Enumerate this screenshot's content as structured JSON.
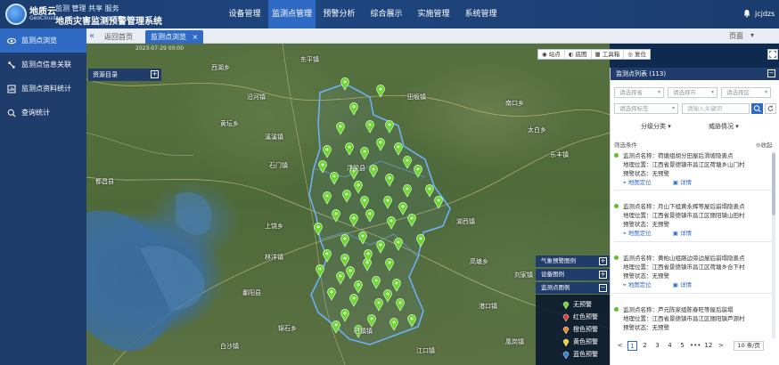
{
  "header": {
    "logo_text": "地质云",
    "logo_sub": "GeoCloud",
    "slogan": "监测 管理 共享 服务",
    "title": "地质灾害监测预警管理系统",
    "nav": [
      "设备管理",
      "监测点管理",
      "预警分析",
      "综合展示",
      "实施管理",
      "系统管理"
    ],
    "active_nav": 1,
    "username": "jcjdzs"
  },
  "sidebar": {
    "items": [
      {
        "label": "监测点浏览",
        "icon": "eye-icon"
      },
      {
        "label": "监测点信息关联",
        "icon": "link-icon"
      },
      {
        "label": "监测点资料统计",
        "icon": "chart-icon"
      },
      {
        "label": "查询统计",
        "icon": "search-icon"
      }
    ],
    "active": 0
  },
  "tabs": {
    "items": [
      "返回首页",
      "监测点浏览"
    ],
    "active": 1,
    "right_label": "页面"
  },
  "map": {
    "resource_dir": "资源目录",
    "timestamp": "2023-07-29 00:00",
    "places": [
      {
        "label": "东平镇"
      },
      {
        "label": "西湖乡"
      },
      {
        "label": "沿河镇"
      },
      {
        "label": "黄坛乡"
      },
      {
        "label": "田坂镇"
      },
      {
        "label": "南口乡"
      },
      {
        "label": "太白乡"
      },
      {
        "label": "溪溪镇"
      },
      {
        "label": "石门镇"
      },
      {
        "label": "乐丰镇"
      },
      {
        "label": "都昌县"
      },
      {
        "label": "鄱阳县"
      },
      {
        "label": "上饶乡"
      },
      {
        "label": "林洋镇"
      },
      {
        "label": "湖西镇"
      },
      {
        "label": "高塘乡"
      },
      {
        "label": "刘家镇"
      },
      {
        "label": "港口镇"
      },
      {
        "label": "江口镇"
      },
      {
        "label": "浮梁县"
      },
      {
        "label": "锦石乡"
      },
      {
        "label": "白沙镇"
      },
      {
        "label": "凰岗镇"
      },
      {
        "label": "石镇镇"
      }
    ],
    "toolbar": [
      "站点",
      "底图",
      "工具箱",
      "复位"
    ],
    "layer_headers": [
      "气象预警图例",
      "设备图例",
      "监测点图例"
    ],
    "legend_title": "监测点图例",
    "legend_items": [
      {
        "label": "无预警",
        "color": "#6cd92e"
      },
      {
        "label": "红色预警",
        "color": "#e23b2e"
      },
      {
        "label": "橙色预警",
        "color": "#f08a1f"
      },
      {
        "label": "黄色预警",
        "color": "#f2d21a"
      },
      {
        "label": "蓝色预警",
        "color": "#2f7fe0"
      }
    ]
  },
  "panel": {
    "title": "监测点列表",
    "count": "(113)",
    "selects": [
      "请选择省",
      "请选择市",
      "请选择区",
      "请选择标签",
      "请输入关键词"
    ],
    "filters": [
      "分级分类",
      "威胁情况"
    ],
    "cond_label": "筛选条件",
    "collapse_label": "收起",
    "card_actions": [
      "地图定位",
      "详情"
    ],
    "cards": [
      {
        "name": "监测点名称：荷塘组胡分田屋后滑坡隐患点",
        "loc": "地理位置：江西省景德镇市昌江区荷塘乡山门村",
        "status": "预警状态：无预警"
      },
      {
        "name": "监测点名称：月山下组黄永辉等屋后崩塌隐患点",
        "loc": "地理位置：江西省景德镇市昌江区丽阳镇山田村",
        "status": "预警状态：无预警"
      },
      {
        "name": "监测点名称：黄柏山组路边旁边屋后崩塌隐患点",
        "loc": "地理位置：江西省景德镇市昌江区荷塘乡合下村",
        "status": "预警状态：无预警"
      },
      {
        "name": "监测点名称：芦元陈家组陈春旺等屋后崩塌",
        "loc": "地理位置：江西省景德镇市昌江区丽阳镇芦源村",
        "status": "预警状态：无预警"
      }
    ],
    "pager": {
      "prev": "<",
      "pages": [
        "1",
        "2",
        "3",
        "4",
        "5",
        "•••",
        "12"
      ],
      "next": ">",
      "active": 0,
      "size": "10 条/页"
    }
  },
  "colors": {
    "header": "#1b3c6e",
    "active": "#2f6bc4",
    "pin_green": "#6cd92e"
  }
}
